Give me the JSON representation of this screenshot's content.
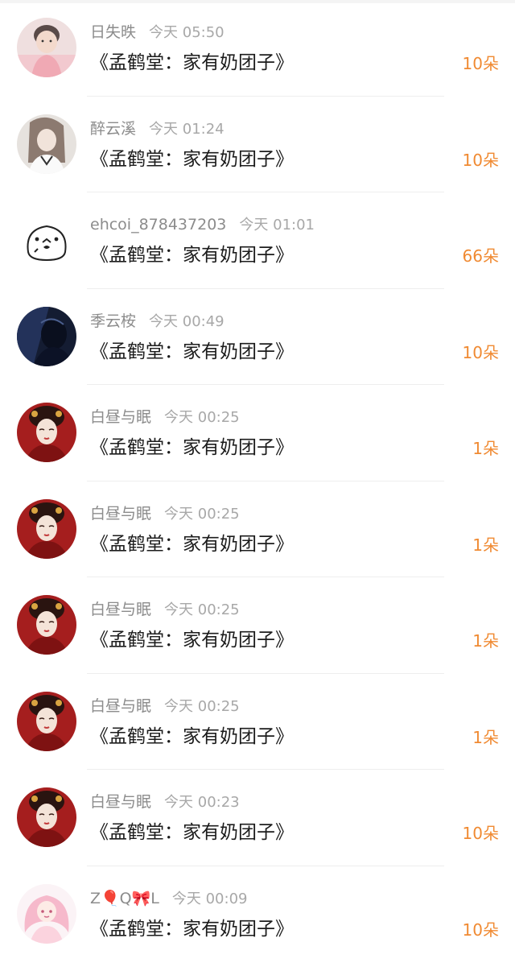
{
  "messages": [
    {
      "name": "日失昳",
      "time": "今天 05:50",
      "title": "《孟鹤堂：家有奶团子》",
      "count": "10朵",
      "avatar_icon": "boy-in-pink-avatar"
    },
    {
      "name": "醉云溪",
      "time": "今天 01:24",
      "title": "《孟鹤堂：家有奶团子》",
      "count": "10朵",
      "avatar_icon": "girl-white-shirt-avatar"
    },
    {
      "name": "ehcoi_878437203",
      "time": "今天 01:01",
      "title": "《孟鹤堂：家有奶团子》",
      "count": "66朵",
      "avatar_icon": "seal-doodle-avatar"
    },
    {
      "name": "季云桉",
      "time": "今天 00:49",
      "title": "《孟鹤堂：家有奶团子》",
      "count": "10朵",
      "avatar_icon": "dark-blue-portrait-avatar"
    },
    {
      "name": "白昼与眠",
      "time": "今天 00:25",
      "title": "《孟鹤堂：家有奶团子》",
      "count": "1朵",
      "avatar_icon": "red-costume-lady-avatar"
    },
    {
      "name": "白昼与眠",
      "time": "今天 00:25",
      "title": "《孟鹤堂：家有奶团子》",
      "count": "1朵",
      "avatar_icon": "red-costume-lady-avatar"
    },
    {
      "name": "白昼与眠",
      "time": "今天 00:25",
      "title": "《孟鹤堂：家有奶团子》",
      "count": "1朵",
      "avatar_icon": "red-costume-lady-avatar"
    },
    {
      "name": "白昼与眠",
      "time": "今天 00:25",
      "title": "《孟鹤堂：家有奶团子》",
      "count": "1朵",
      "avatar_icon": "red-costume-lady-avatar"
    },
    {
      "name": "白昼与眠",
      "time": "今天 00:23",
      "title": "《孟鹤堂：家有奶团子》",
      "count": "10朵",
      "avatar_icon": "red-costume-lady-avatar"
    },
    {
      "name": "Z🎈Q🎀L",
      "time": "今天 00:09",
      "title": "《孟鹤堂：家有奶团子》",
      "count": "10朵",
      "avatar_icon": "pink-anime-girl-avatar"
    }
  ],
  "colors": {
    "count": "#f08a32",
    "name": "#8c8c8c",
    "time": "#a8a8a8",
    "title": "#1c1c1c",
    "divider": "#eeeeee"
  }
}
